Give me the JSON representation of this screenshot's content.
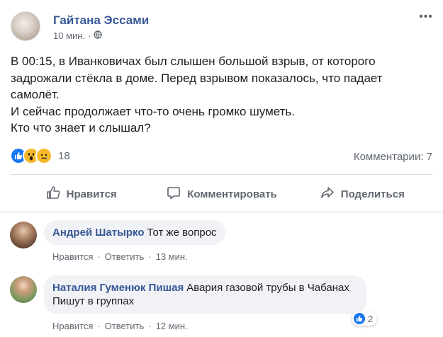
{
  "post": {
    "author": "Гайтана Эссами",
    "time": "10 мин.",
    "dot": "·",
    "more": "•••",
    "text_lines": [
      "В 00:15, в Иванковичах был слышен большой взрыв, от которого",
      "задрожали стёкла в доме. Перед взрывом показалось, что падает",
      "самолёт.",
      "И сейчас продолжает что-то очень громко шуметь.",
      "Кто что знает и слышал?"
    ],
    "reaction_count": "18",
    "comments_count": "Комментарии: 7",
    "reactions": [
      "like-icon",
      "wow-icon",
      "sad-icon"
    ]
  },
  "actions": {
    "like": "Нравится",
    "comment": "Комментировать",
    "share": "Поделиться"
  },
  "comments": [
    {
      "name": "Андрей Шатырко",
      "text": "Тот же вопрос",
      "like": "Нравится",
      "reply": "Ответить",
      "sep": "·",
      "time": "13 мин."
    },
    {
      "name": "Наталия Гуменюк Пишая",
      "text": "Авария газовой трубы в Чабанах",
      "text2": "Пишут в группах",
      "like": "Нравится",
      "reply": "Ответить",
      "sep": "·",
      "time": "12 мин.",
      "reaction_count": "2"
    }
  ]
}
